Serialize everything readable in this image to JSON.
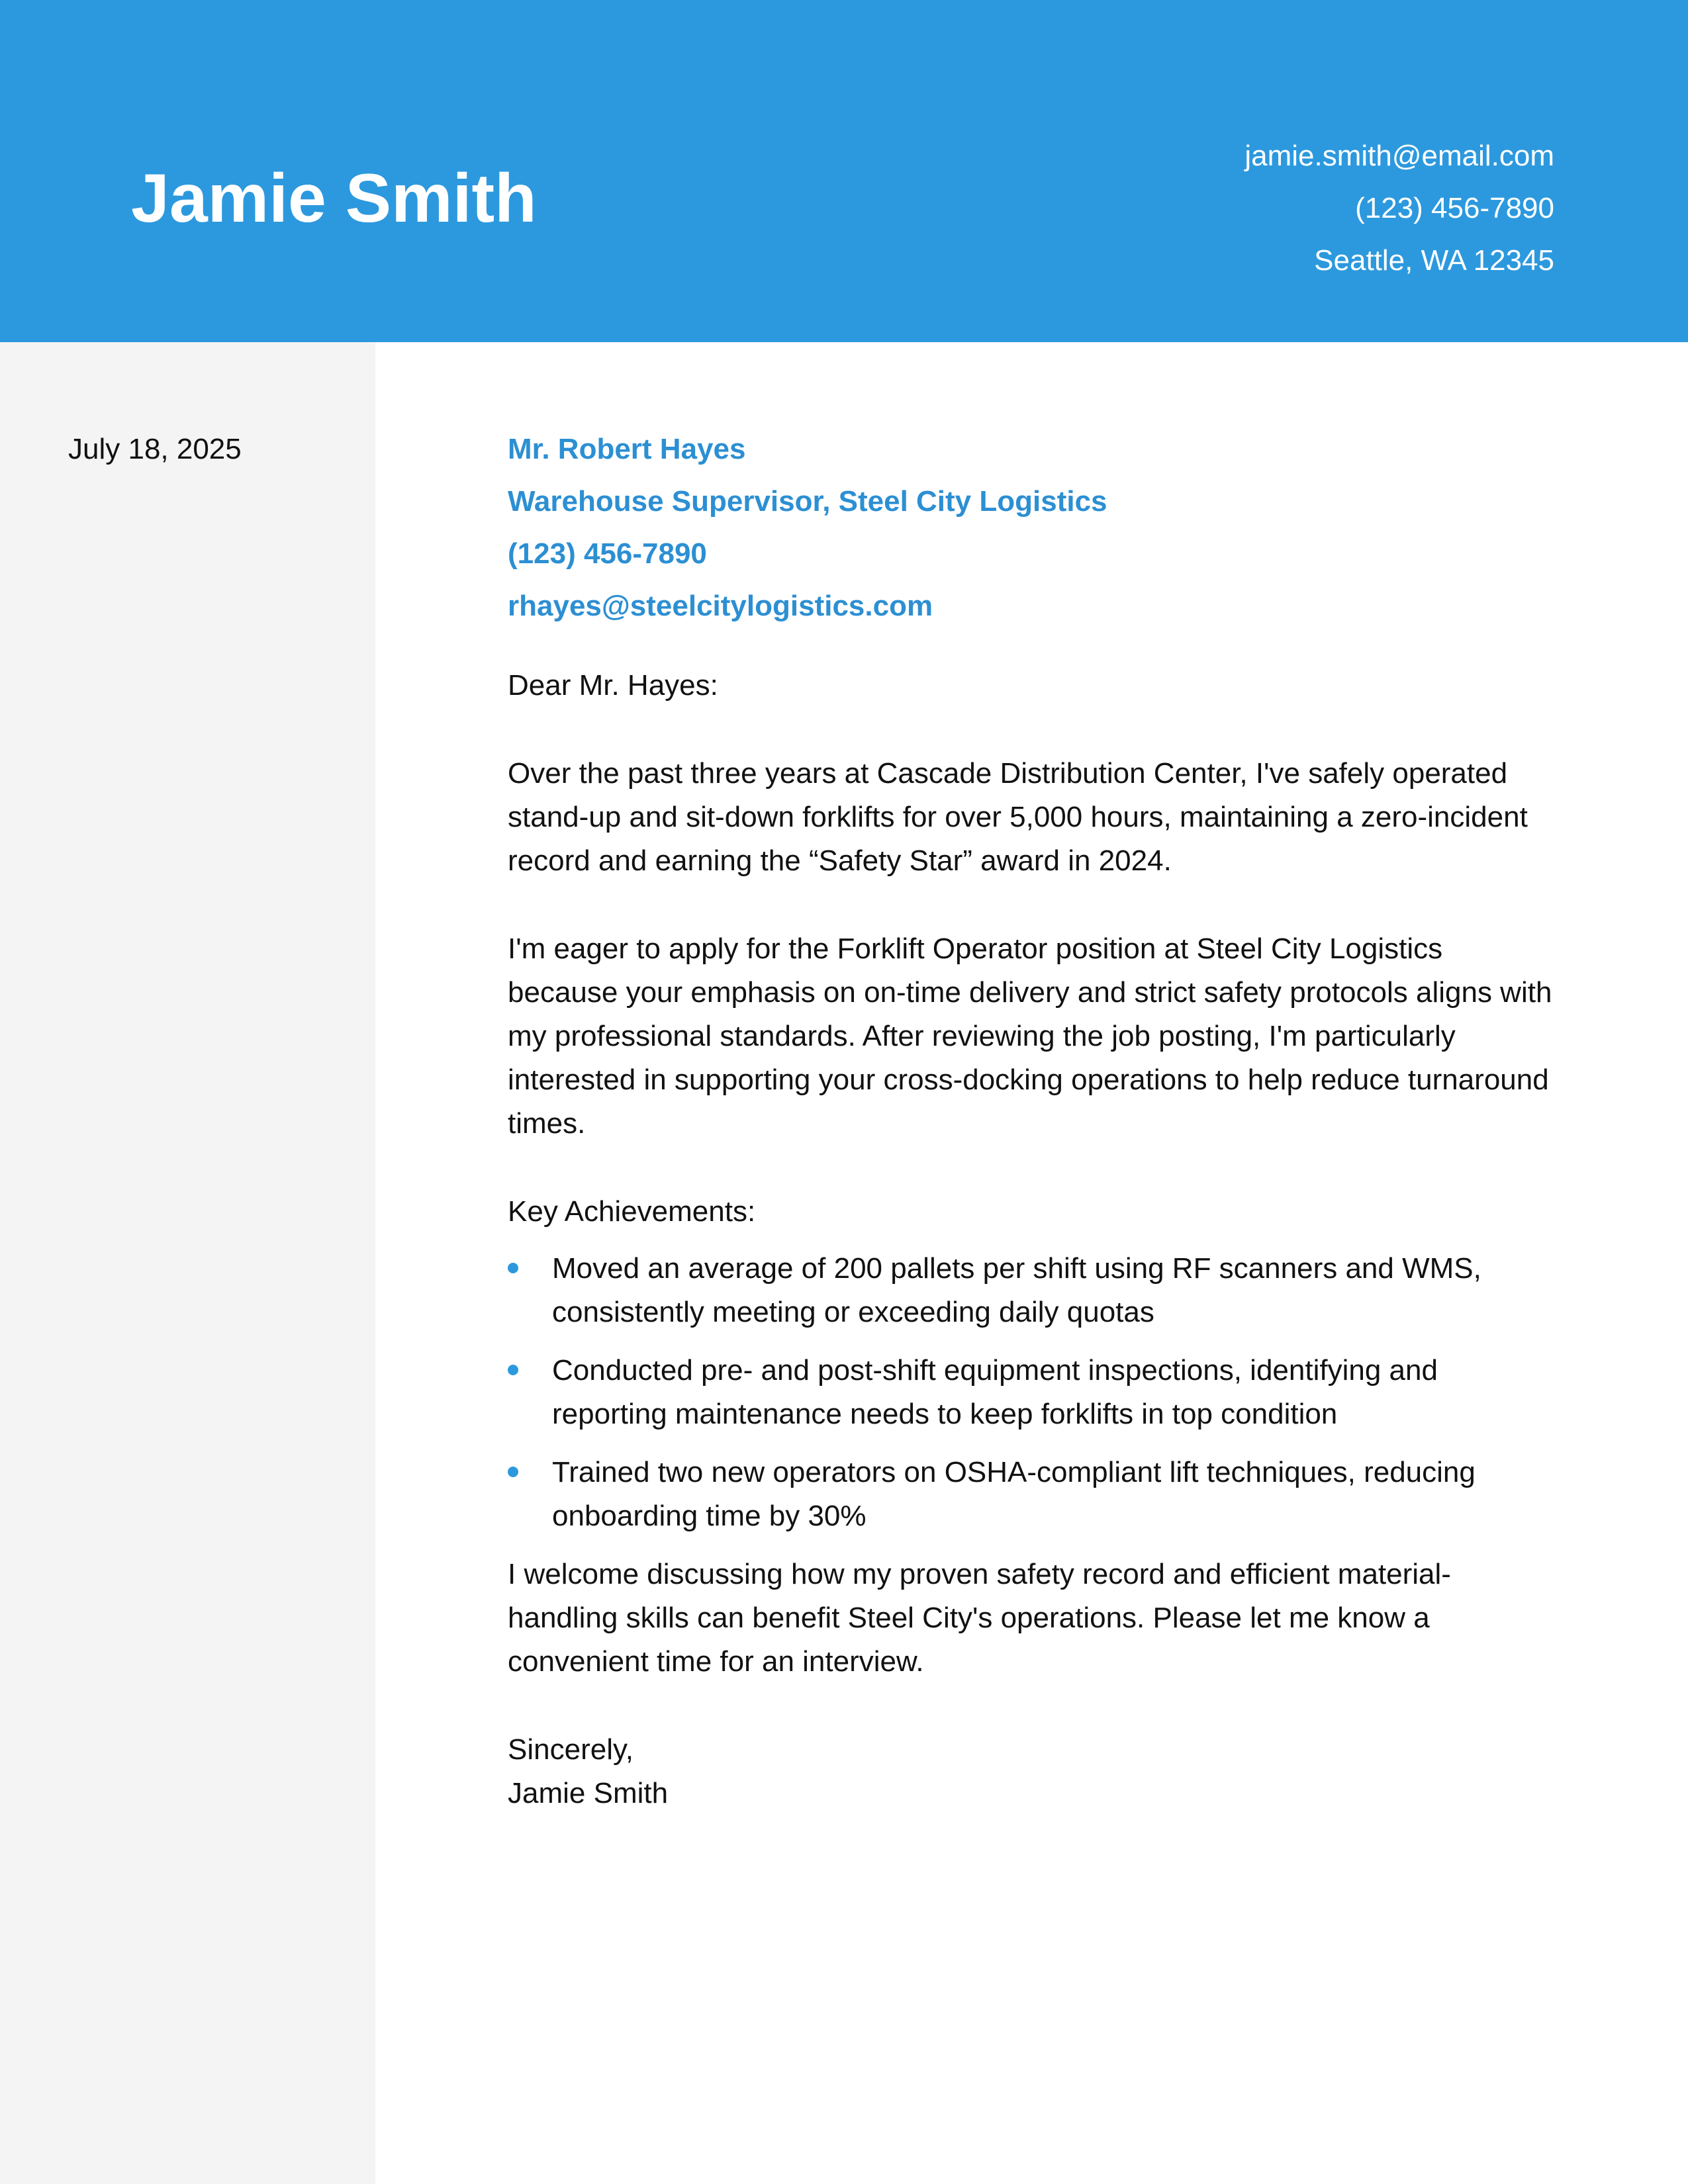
{
  "header": {
    "name": "Jamie Smith",
    "email": "jamie.smith@email.com",
    "phone": "(123) 456-7890",
    "location": "Seattle, WA 12345",
    "accent_color": "#2c99de"
  },
  "sidebar": {
    "date": "July 18, 2025",
    "background_color": "#f4f4f4"
  },
  "recipient": {
    "name": "Mr. Robert Hayes",
    "title": "Warehouse Supervisor, Steel City Logistics",
    "phone": "(123) 456-7890",
    "email": "rhayes@steelcitylogistics.com"
  },
  "letter": {
    "salutation": "Dear Mr. Hayes:",
    "paragraph1": "Over the past three years at Cascade Distribution Center, I've safely operated stand-up and sit-down forklifts for over 5,000 hours, maintaining a zero-incident record and earning the “Safety Star” award in 2024.",
    "paragraph2": "I'm eager to apply for the Forklift Operator position at Steel City Logistics because your emphasis on on-time delivery and strict safety protocols aligns with my professional standards. After reviewing the job posting, I'm particularly interested in supporting your cross-docking operations to help reduce turnaround times.",
    "achievements_heading": "Key Achievements:",
    "achievements": [
      "Moved an average of 200 pallets per shift using RF scanners and WMS, consistently meeting or exceeding daily quotas",
      "Conducted pre- and post-shift equipment inspections, identifying and reporting maintenance needs to keep forklifts in top condition",
      "Trained two new operators on OSHA-compliant lift techniques, reducing onboarding time by 30%"
    ],
    "paragraph3": "I welcome discussing how my proven safety record and efficient material-handling skills can benefit Steel City's operations. Please let me know a convenient time for an interview.",
    "closing": "Sincerely,",
    "signature": "Jamie Smith"
  }
}
